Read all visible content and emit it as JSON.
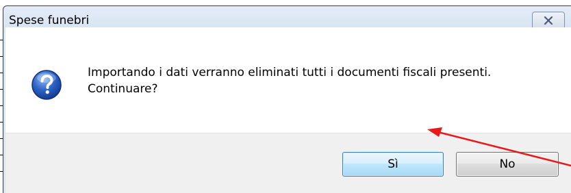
{
  "dialog": {
    "title": "Spese funebri",
    "message_line1": "Importando i dati verranno eliminati tutti i documenti fiscali presenti.",
    "message_line2": "Continuare?",
    "icon": "question-icon",
    "buttons": {
      "yes_label": "Sì",
      "no_label": "No"
    },
    "close_icon": "close-icon"
  },
  "colors": {
    "titlebar": "#dbe5f1",
    "default_button": "#bee6fd",
    "annotation_arrow": "#e8191a"
  }
}
